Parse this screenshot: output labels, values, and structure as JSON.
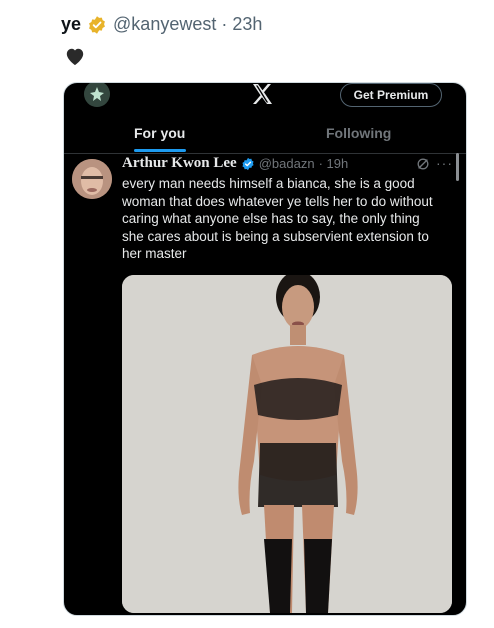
{
  "outer": {
    "name": "ye",
    "handle_time": "@kanyewest · 23h"
  },
  "colors": {
    "badge_gold": "#e8b32a",
    "accent_blue": "#1d9bf0",
    "card_bg": "#000000"
  },
  "topbar": {
    "premium_label": "Get Premium"
  },
  "tabs": [
    {
      "label": "For you",
      "active": true
    },
    {
      "label": "Following",
      "active": false
    }
  ],
  "post": {
    "author": "Arthur Kwon Lee",
    "handle": "@badazn",
    "time": "· 19h",
    "more": "···",
    "text": "every man needs himself a bianca, she is a good woman that does whatever ye tells her to do without caring what anyone else has to say, the only thing she cares about is being a subservient extension to her master"
  },
  "icons": [
    "verified-badge-icon",
    "heart-icon",
    "x-logo-icon",
    "grok-icon",
    "more-icon"
  ]
}
